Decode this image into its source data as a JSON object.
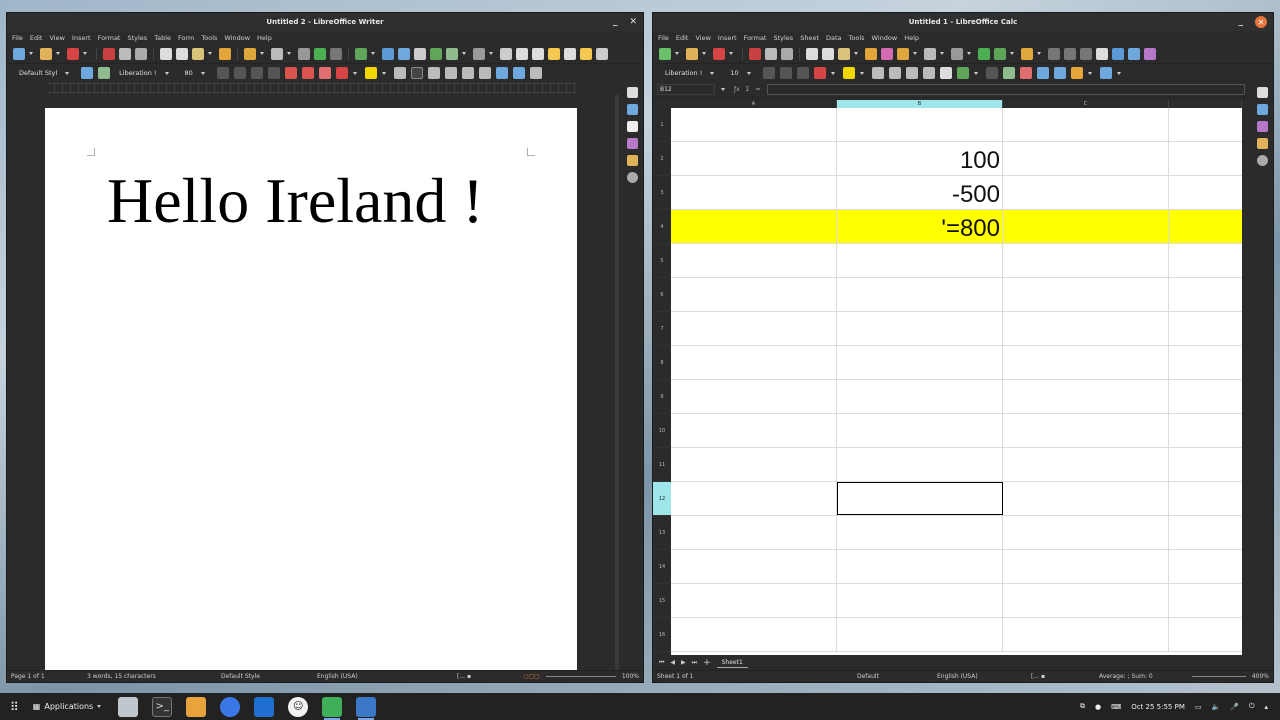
{
  "writer": {
    "title": "Untitled 2 - LibreOffice Writer",
    "menu": [
      "File",
      "Edit",
      "View",
      "Insert",
      "Format",
      "Styles",
      "Table",
      "Form",
      "Tools",
      "Window",
      "Help"
    ],
    "paragraph_style": "Default Styl",
    "font_name": "Liberation !",
    "font_size": "80",
    "document_text": "Hello Ireland !",
    "status": {
      "page": "Page 1 of 1",
      "words": "3 words, 15 characters",
      "page_style": "Default Style",
      "language": "English (USA)",
      "zoom": "100%"
    }
  },
  "calc": {
    "title": "Untitled 1 - LibreOffice Calc",
    "menu": [
      "File",
      "Edit",
      "View",
      "Insert",
      "Format",
      "Styles",
      "Sheet",
      "Data",
      "Tools",
      "Window",
      "Help"
    ],
    "font_name": "Liberation !",
    "font_size": "10",
    "name_box": "B12",
    "columns": [
      "A",
      "B",
      "C"
    ],
    "rows": [
      "1",
      "2",
      "3",
      "4",
      "5",
      "6",
      "7",
      "8",
      "9",
      "10",
      "11",
      "12",
      "13",
      "14",
      "15",
      "16"
    ],
    "cells": {
      "B2": "100",
      "B3": "-500",
      "B4": "'=800"
    },
    "sheet_tab": "Sheet1",
    "status": {
      "sheet": "Sheet 1 of 1",
      "page_style": "Default",
      "language": "English (USA)",
      "summary": "Average: ; Sum: 0",
      "zoom": "400%"
    }
  },
  "taskbar": {
    "applications_label": "Applications",
    "clock": "Oct 25  5:55 PM"
  },
  "colors": {
    "highlight_row": "#ffff00",
    "active_header": "#9fe6ea",
    "close_button": "#e8753b"
  }
}
